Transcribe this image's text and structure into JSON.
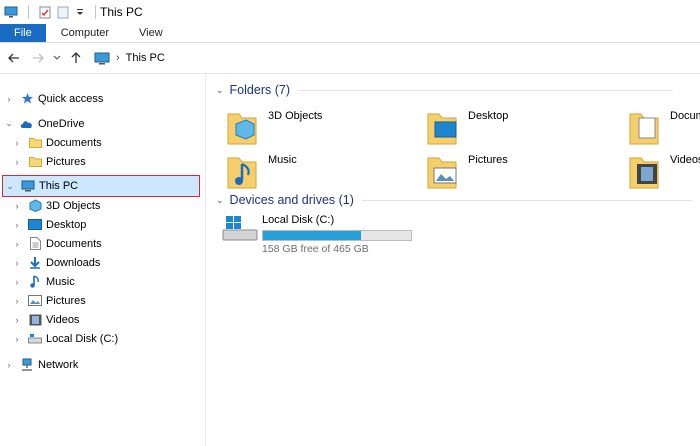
{
  "window": {
    "title": "This PC"
  },
  "ribbon": {
    "tabs": [
      "File",
      "Computer",
      "View"
    ]
  },
  "address": {
    "crumb": "This PC"
  },
  "nav": {
    "quick_access": "Quick access",
    "onedrive": "OneDrive",
    "documents": "Documents",
    "pictures": "Pictures",
    "this_pc": "This PC",
    "objects3d": "3D Objects",
    "desktop": "Desktop",
    "documents2": "Documents",
    "downloads": "Downloads",
    "music": "Music",
    "pictures2": "Pictures",
    "videos": "Videos",
    "local_disk": "Local Disk (C:)",
    "network": "Network"
  },
  "main": {
    "folders_header": "Folders (7)",
    "folders": [
      "3D Objects",
      "Desktop",
      "Documents",
      "Music",
      "Pictures",
      "Videos"
    ],
    "drives_header": "Devices and drives (1)",
    "drive": {
      "name": "Local Disk (C:)",
      "free_text": "158 GB free of 465 GB",
      "used_fraction": 0.66
    }
  },
  "colors": {
    "accent": "#1a6bc2",
    "selection": "#cce8ff",
    "highlight_border": "#e0262b",
    "header_blue": "#1e3287",
    "drive_bar": "#26a0da"
  }
}
